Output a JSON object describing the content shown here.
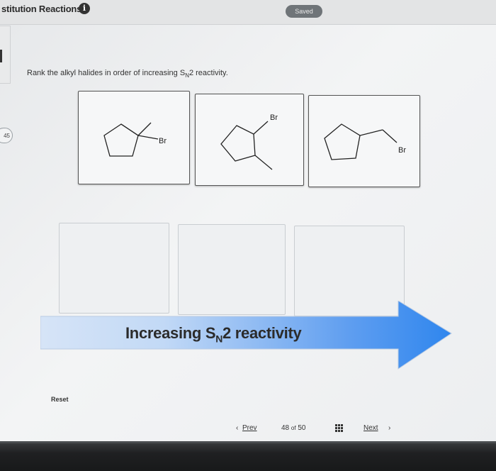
{
  "header": {
    "app_title": "stitution Reactions",
    "info_icon": "info-icon",
    "saved_label": "Saved"
  },
  "sidebar": {
    "question_number": "45"
  },
  "question": {
    "prompt_pre": "Rank the alkyl halides in order of increasing S",
    "prompt_sub": "N",
    "prompt_post": "2 reactivity.",
    "molecules": [
      {
        "id": "tertiary",
        "halogen_label": "Br"
      },
      {
        "id": "secondary",
        "halogen_label": "Br"
      },
      {
        "id": "primary",
        "halogen_label": "Br"
      }
    ],
    "slot_count": 3
  },
  "arrow": {
    "label_pre": "Increasing S",
    "label_sub": "N",
    "label_post": "2 reactivity",
    "color": "#3d8ef0"
  },
  "controls": {
    "reset_label": "Reset"
  },
  "pagination": {
    "prev_label": "Prev",
    "current": "48",
    "of_label": "of",
    "total": "50",
    "next_label": "Next"
  }
}
